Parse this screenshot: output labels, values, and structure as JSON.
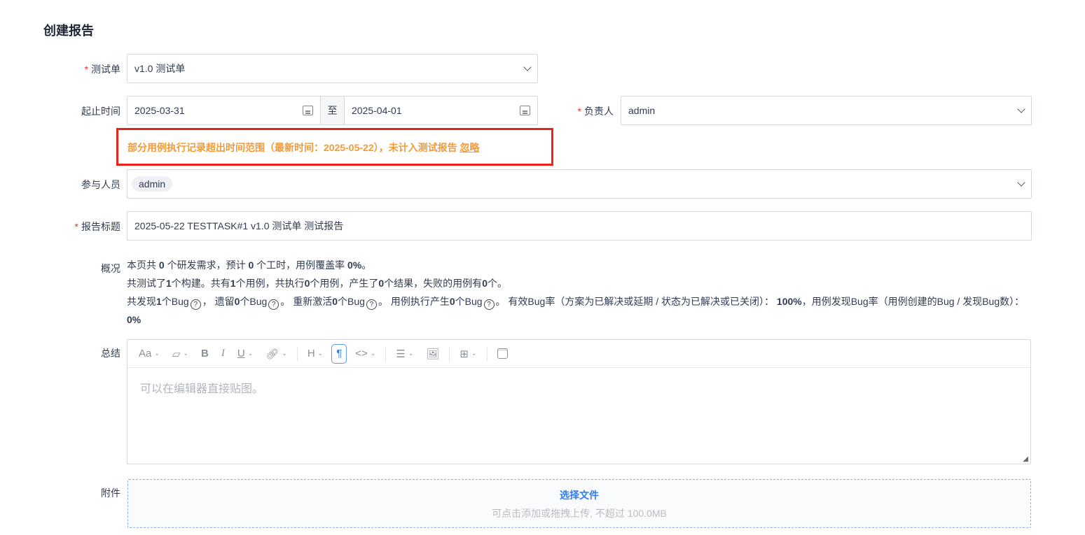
{
  "page_title": "创建报告",
  "required_mark": "*",
  "testtask": {
    "label": "测试单",
    "value": "v1.0 测试单"
  },
  "dates": {
    "label": "起止时间",
    "begin": "2025-03-31",
    "sep": "至",
    "end": "2025-04-01"
  },
  "owner": {
    "label": "负责人",
    "value": "admin"
  },
  "warning": {
    "text": "部分用例执行记录超出时间范围（最新时间：2025-05-22），未计入测试报告",
    "ignore": "忽略",
    "color": "#f29b38",
    "border": "#e8241c"
  },
  "members": {
    "label": "参与人员",
    "tags": [
      "admin"
    ]
  },
  "report_title": {
    "label": "报告标题",
    "value": "2025-05-22 TESTTASK#1 v1.0 测试单 测试报告"
  },
  "overview": {
    "label": "概况",
    "help": "?",
    "lines": [
      [
        [
          "本页共 ",
          0
        ],
        [
          "0",
          1
        ],
        [
          " 个研发需求，预计 ",
          0
        ],
        [
          "0",
          1
        ],
        [
          " 个工时，用例覆盖率 ",
          0
        ],
        [
          "0%",
          1
        ],
        [
          "。",
          0
        ]
      ],
      [
        [
          "共测试了",
          0
        ],
        [
          "1",
          1
        ],
        [
          "个构建。共有",
          0
        ],
        [
          "1",
          1
        ],
        [
          "个用例，共执行",
          0
        ],
        [
          "0",
          1
        ],
        [
          "个用例，产生了",
          0
        ],
        [
          "0",
          1
        ],
        [
          "个结果，失败的用例有",
          0
        ],
        [
          "0",
          1
        ],
        [
          "个。",
          0
        ]
      ],
      [
        [
          "共发现",
          0
        ],
        [
          "1",
          1
        ],
        [
          "个Bug",
          0
        ],
        [
          "?",
          2
        ],
        [
          "，  遗留",
          0
        ],
        [
          "0",
          1
        ],
        [
          "个Bug",
          0
        ],
        [
          "?",
          2
        ],
        [
          "。 重新激活",
          0
        ],
        [
          "0",
          1
        ],
        [
          "个Bug",
          0
        ],
        [
          "?",
          2
        ],
        [
          "。 用例执行产生",
          0
        ],
        [
          "0",
          1
        ],
        [
          "个Bug",
          0
        ],
        [
          "?",
          2
        ],
        [
          "。  有效Bug率（方案为已解决或延期 / 状态为已解决或已关闭）：",
          0
        ],
        [
          " 100%",
          1
        ],
        [
          "，用例发现Bug率（用例创建的Bug / 发现Bug数）：",
          0
        ],
        [
          " 0%",
          1
        ]
      ]
    ]
  },
  "summary": {
    "label": "总结",
    "placeholder": "可以在编辑器直接贴图。",
    "toolbar": [
      "font-size",
      "font-color",
      "bold",
      "italic",
      "underline",
      "link",
      "heading",
      "paragraph",
      "code",
      "list",
      "image",
      "table",
      "block"
    ]
  },
  "attachment": {
    "label": "附件",
    "button": "选择文件",
    "hint": "可点击添加或拖拽上传, 不超过 100.0MB"
  }
}
